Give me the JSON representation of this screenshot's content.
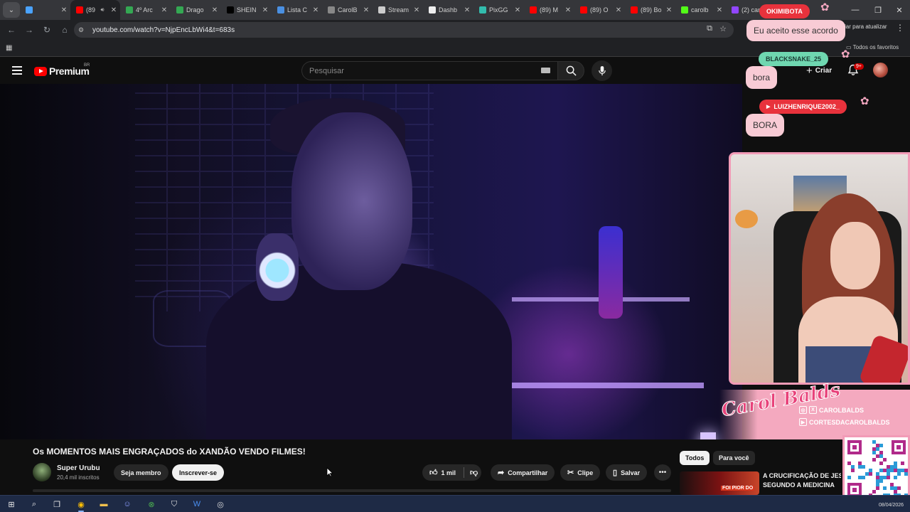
{
  "browser": {
    "tabs": [
      {
        "label": "",
        "icon": "gem-icon",
        "color": "#4aa3ff",
        "active": false
      },
      {
        "label": "(89",
        "icon": "youtube-icon",
        "color": "#ff0000",
        "active": true
      },
      {
        "label": "4º Arc",
        "icon": "drive-icon",
        "color": "#34a853",
        "active": false
      },
      {
        "label": "Drago",
        "icon": "drive-icon",
        "color": "#34a853",
        "active": false
      },
      {
        "label": "SHEIN",
        "icon": "shein-icon",
        "color": "#000000",
        "active": false
      },
      {
        "label": "Lista C",
        "icon": "cloud-icon",
        "color": "#4a90e2",
        "active": false
      },
      {
        "label": "CarolB",
        "icon": "globe-icon",
        "color": "#888888",
        "active": false
      },
      {
        "label": "Stream",
        "icon": "anchor-icon",
        "color": "#cccccc",
        "active": false
      },
      {
        "label": "Dashb",
        "icon": "dashboard-icon",
        "color": "#eeeeee",
        "active": false
      },
      {
        "label": "PixGG",
        "icon": "pix-icon",
        "color": "#32bcad",
        "active": false
      },
      {
        "label": "(89) M",
        "icon": "youtube-icon",
        "color": "#ff0000",
        "active": false
      },
      {
        "label": "(89) O",
        "icon": "youtube-icon",
        "color": "#ff0000",
        "active": false
      },
      {
        "label": "(89) Bo",
        "icon": "youtube-icon",
        "color": "#ff0000",
        "active": false
      },
      {
        "label": "carolb",
        "icon": "kick-icon",
        "color": "#53fc18",
        "active": false
      },
      {
        "label": "(2) car",
        "icon": "twitch-icon",
        "color": "#9146ff",
        "active": false
      }
    ],
    "url": "youtube.com/watch?v=NjpEncLbWi4&t=683s",
    "update_label": "ciar para atualizar",
    "all_favorites": "Todos os favoritos"
  },
  "youtube": {
    "logo_text": "Premium",
    "region": "BR",
    "search_placeholder": "Pesquisar",
    "create_label": "Criar",
    "notifications_badge": "9+",
    "video": {
      "title": "Os MOMENTOS MAIS ENGRAÇADOS do XANDÃO VENDO FILMES!",
      "channel": "Super Urubu",
      "subscribers": "20,4 mil inscritos",
      "join_label": "Seja membro",
      "subscribe_label": "Inscrever-se",
      "likes": "1 mil",
      "share_label": "Compartilhar",
      "clip_label": "Clipe",
      "save_label": "Salvar"
    },
    "chips": {
      "all": "Todos",
      "for_you": "Para você"
    },
    "recommendation": {
      "title_line1": "A CRUCIFICAÇÃO DE JESUS",
      "title_line2": "SEGUNDO A MEDICINA",
      "thumb_text": "FOI PIOR DO"
    }
  },
  "overlay": {
    "chat": [
      {
        "user": "OKIMIBOTA",
        "message": "Eu aceito esse acordo",
        "tag_color": "#e8323c"
      },
      {
        "user": "BLACKSNAKE_25",
        "message": "bora",
        "tag_color": "#6fd7b0"
      },
      {
        "user": "LUIZHENRIQUE2002_",
        "message": "BORA",
        "tag_color": "#e8323c"
      }
    ],
    "brand_logo": "Carol Balds",
    "socials": [
      {
        "icon": "x-icon",
        "handle": "CAROLBALDS"
      },
      {
        "icon": "youtube-icon",
        "handle": "CORTESDACAROLBALDS"
      }
    ]
  },
  "taskbar": {
    "date": "08/04/2026",
    "apps": [
      "windows-start-icon",
      "search-icon",
      "task-view-icon",
      "chrome-icon",
      "file-explorer-icon",
      "discord-icon",
      "xbox-icon",
      "security-icon",
      "word-icon",
      "obs-icon"
    ]
  }
}
